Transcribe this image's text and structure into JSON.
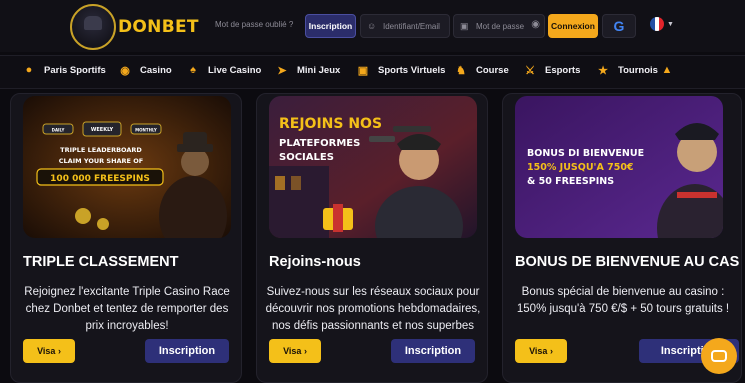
{
  "brand": {
    "name": "DONBET"
  },
  "header": {
    "forgot_password": "Mot de passe oublié ?",
    "register_label": "Inscription",
    "username_placeholder": "Identifiant/Email",
    "password_placeholder": "Mot de passe",
    "login_label": "Connexion",
    "google_label": "G"
  },
  "nav": {
    "items": [
      {
        "label": "Paris Sportifs",
        "icon": "basketball-icon"
      },
      {
        "label": "Casino",
        "icon": "money-bag-icon"
      },
      {
        "label": "Live Casino",
        "icon": "spade-icon"
      },
      {
        "label": "Mini Jeux",
        "icon": "rocket-icon"
      },
      {
        "label": "Sports Virtuels",
        "icon": "gamepad-icon"
      },
      {
        "label": "Course",
        "icon": "horse-icon"
      },
      {
        "label": "Esports",
        "icon": "soldier-icon"
      },
      {
        "label": "Tournois",
        "icon": "trophy-icon"
      }
    ]
  },
  "cards": [
    {
      "title": "TRIPLE CLASSEMENT",
      "desc": [
        "Rejoignez l'excitante Triple Casino Race",
        "chez Donbet et tentez de remporter des",
        "prix incroyables!"
      ],
      "visa": "Visa",
      "register": "Inscription",
      "banner": {
        "line1": "TRIPLE LEADERBOARD",
        "line2": "CLAIM YOUR SHARE OF",
        "line3": "100 000 FREESPINS",
        "tag1": "DAILY",
        "tag2": "WEEKLY",
        "tag3": "MONTHLY"
      }
    },
    {
      "title": "Rejoins-nous",
      "desc": [
        "Suivez-nous sur les réseaux sociaux pour",
        "découvrir nos promotions hebdomadaires,",
        "nos défis passionnants et nos superbes"
      ],
      "visa": "Visa",
      "register": "Inscription",
      "banner": {
        "line1": "REJOINS NOS",
        "line2": "PLATEFORMES",
        "line3": "SOCIALES"
      }
    },
    {
      "title": "BONUS DE BIENVENUE AU CAS",
      "desc": [
        "Bonus spécial de bienvenue au casino :",
        "150% jusqu'à 750 €/$  + 50 tours gratuits !"
      ],
      "visa": "Visa",
      "register": "Inscription",
      "banner": {
        "line1": "BONUS DI BIENVENUE",
        "line2": "150% JUSQU'A 750€",
        "line3": "& 50 FREESPINS"
      }
    }
  ],
  "colors": {
    "accent": "#f4a81c",
    "visa": "#f4c019",
    "inscription": "#2e3079"
  }
}
